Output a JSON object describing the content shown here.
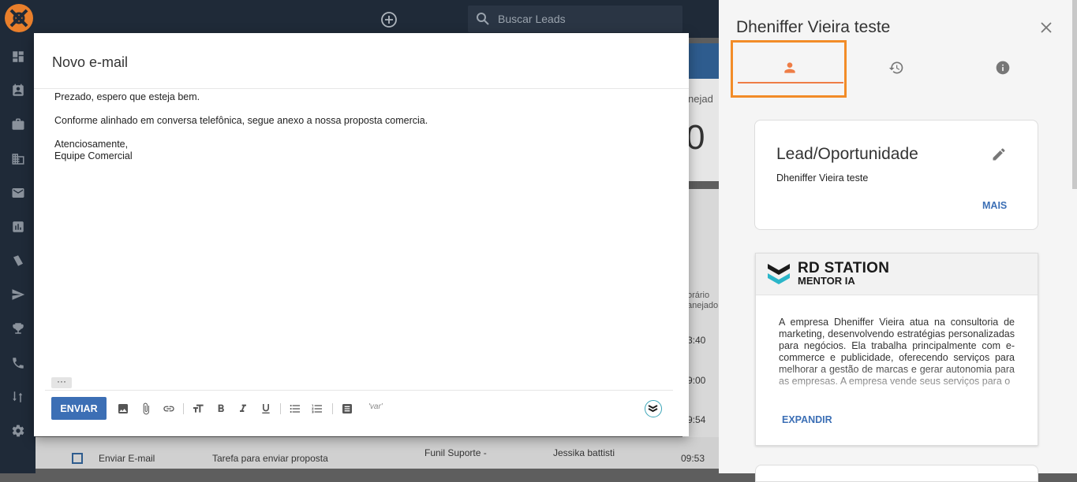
{
  "topbar": {
    "search_placeholder": "Buscar Leads"
  },
  "background": {
    "col_header_1": "nejad",
    "big_digit": "0",
    "col_header_2a": "orário",
    "col_header_2b": "anejado",
    "time_1": "3:40",
    "time_2": "9:00",
    "time_3": "9:54",
    "row_task": "Enviar E-mail",
    "row_desc": "Tarefa para enviar proposta",
    "row_funnel": "Funil Suporte -",
    "row_owner": "Jessika battisti",
    "row_time": "09:53"
  },
  "email_modal": {
    "title": "Novo e-mail",
    "body": {
      "line1": "Prezado, espero que esteja bem.",
      "line2": "Conforme alinhado em conversa telefônica, segue anexo a nossa proposta comercia.",
      "line3": "Atenciosamente,",
      "line4": "Equipe Comercial"
    },
    "more_label": "···",
    "send_label": "ENVIAR",
    "var_label": "'var'"
  },
  "panel": {
    "title": "Dheniffer Vieira teste",
    "lead_card": {
      "title": "Lead/Oportunidade",
      "name": "Dheniffer Vieira teste",
      "more_label": "MAIS"
    },
    "mentor_card": {
      "brand": "RD STATION",
      "sub": "MENTOR IA",
      "text": "A empresa Dheniffer Vieira atua na consultoria de marketing, desenvolvendo estratégias personalizadas para negócios. Ela trabalha principalmente com e-commerce e publicidade, oferecendo serviços para melhorar a gestão de marcas e gerar autonomia para as empresas. A empresa vende seus serviços para o",
      "expand_label": "EXPANDIR"
    }
  },
  "colors": {
    "sidebar_bg": "#1f2a38",
    "accent_orange": "#ee7d46",
    "highlight_orange": "#f28c28",
    "link_blue": "#3c6fb5"
  }
}
